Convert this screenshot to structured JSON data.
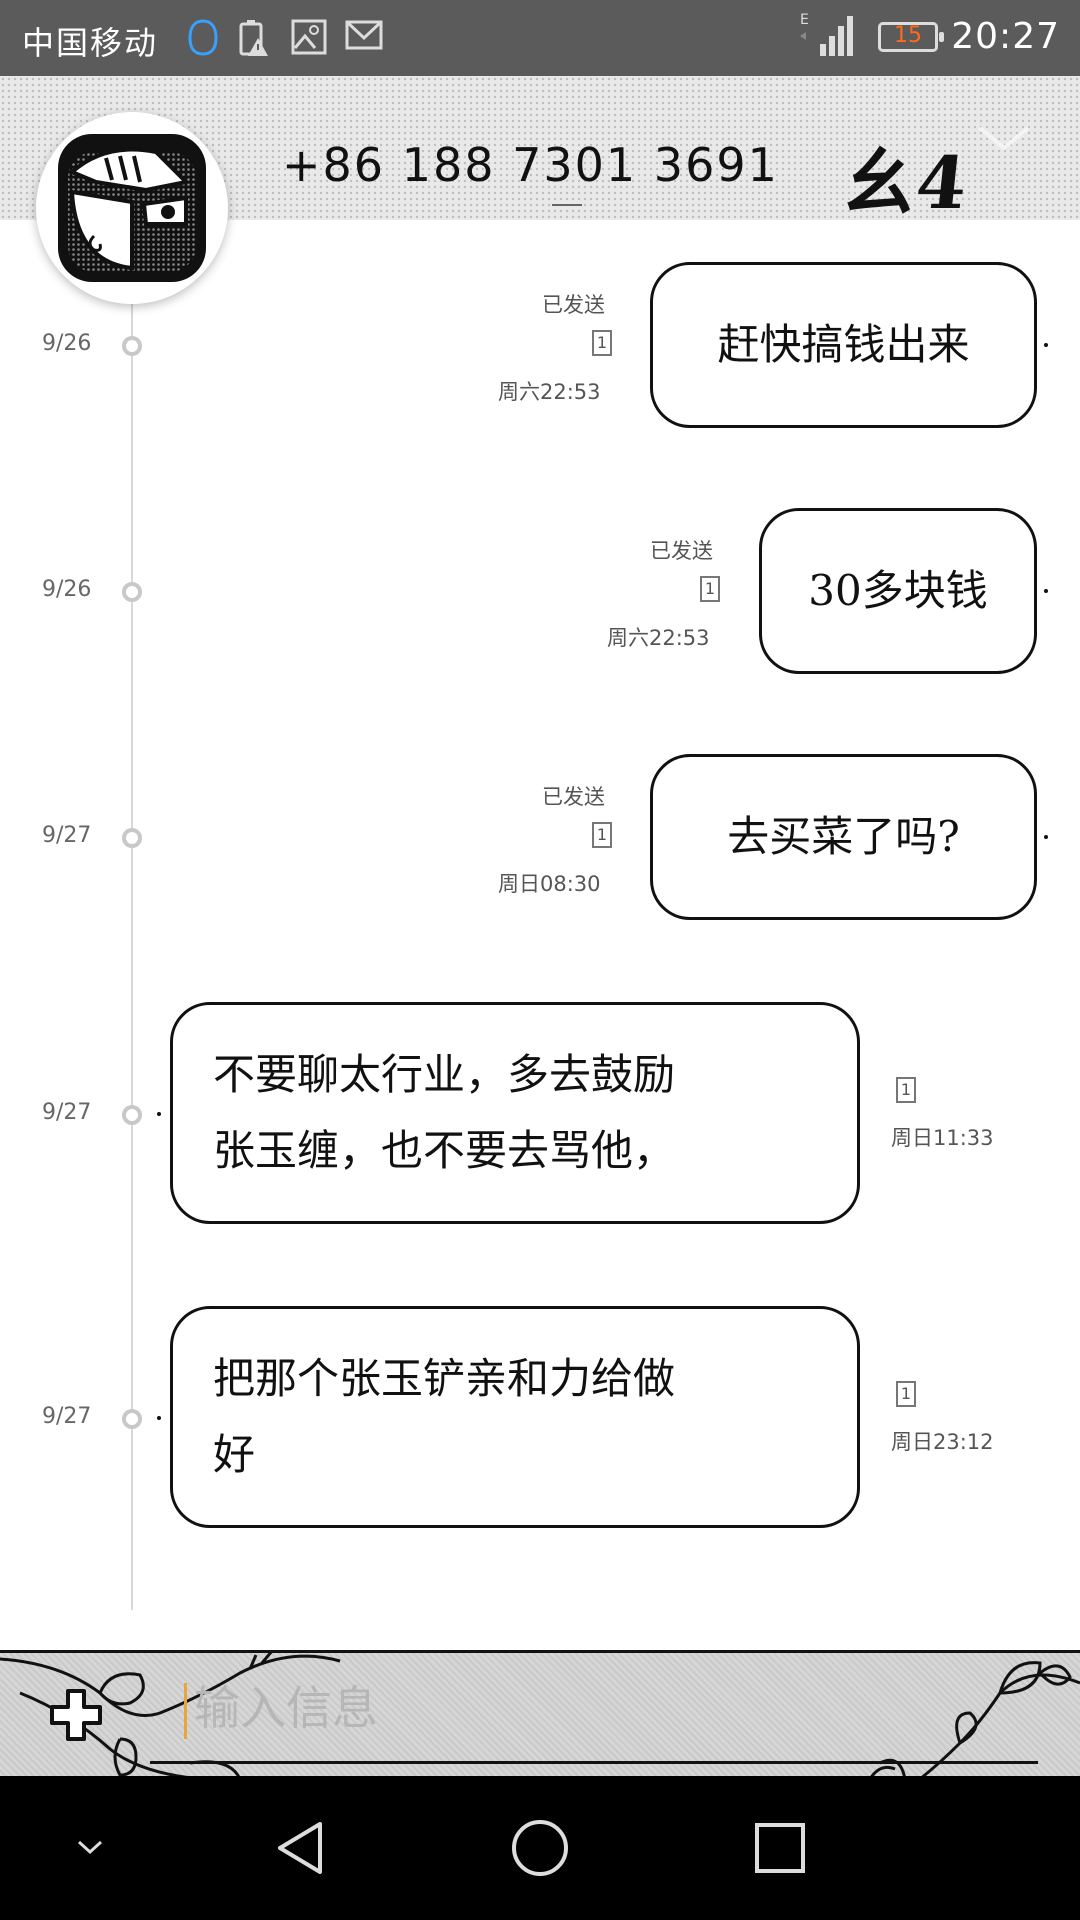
{
  "status_bar": {
    "carrier": "中国移动",
    "battery_level": "15",
    "time": "20:27",
    "icons": [
      "notification-badge-icon",
      "battery-warning-icon",
      "image-icon",
      "mail-icon",
      "signal-icon",
      "battery-icon"
    ]
  },
  "header": {
    "phone_number": "+86 188 7301 3691",
    "contact_name": "幺4",
    "icons": [
      "avatar",
      "chevron-down-icon"
    ]
  },
  "messages": [
    {
      "direction": "sent",
      "date": "9/26",
      "status": "已发送",
      "sim": "1",
      "time": "周六22:53",
      "text": "赶快搞钱出来"
    },
    {
      "direction": "sent",
      "date": "9/26",
      "status": "已发送",
      "sim": "1",
      "time": "周六22:53",
      "text": "30多块钱"
    },
    {
      "direction": "sent",
      "date": "9/27",
      "status": "已发送",
      "sim": "1",
      "time": "周日08:30",
      "text": "去买菜了吗?"
    },
    {
      "direction": "received",
      "date": "9/27",
      "sim": "1",
      "time": "周日11:33",
      "text": "不要聊太行业，多去鼓励张玉缠，也不要去骂他，",
      "lines": [
        "不要聊太行业，多去鼓励",
        "张玉缠，也不要去骂他，"
      ]
    },
    {
      "direction": "received",
      "date": "9/27",
      "sim": "1",
      "time": "周日23:12",
      "text": "把那个张玉铲亲和力给做好",
      "lines": [
        "把那个张玉铲亲和力给做",
        "好"
      ]
    }
  ],
  "input": {
    "placeholder": "输入信息"
  },
  "nav_bar": {
    "icons": [
      "hide-keyboard-icon",
      "back-icon",
      "home-icon",
      "recents-icon"
    ]
  },
  "colors": {
    "status_bar_bg": "#5b5b5b",
    "battery_text": "#ff6a1a",
    "cursor": "#e7a63b",
    "nav_bar_bg": "#000000"
  }
}
